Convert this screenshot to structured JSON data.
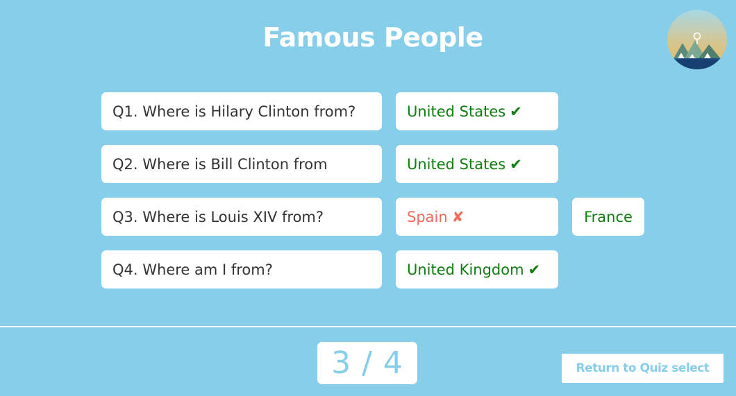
{
  "page": {
    "title": "Famous People"
  },
  "questions": [
    {
      "text": "Q1. Where is Hilary Clinton from?",
      "answer": "United States",
      "mark": "✔",
      "status": "correct"
    },
    {
      "text": "Q2. Where is Bill Clinton from",
      "answer": "United States",
      "mark": "✔",
      "status": "correct"
    },
    {
      "text": "Q3. Where is Louis XIV from?",
      "answer": "Spain",
      "mark": "✘",
      "status": "wrong",
      "correct_answer": "France"
    },
    {
      "text": "Q4. Where am I from?",
      "answer": "United Kingdom",
      "mark": "✔",
      "status": "correct"
    }
  ],
  "score": {
    "text": "3 / 4",
    "correct": 3,
    "total": 4
  },
  "footer": {
    "return_label": "Return to Quiz select"
  },
  "colors": {
    "background": "#87ceeb",
    "correct": "#0f7d0f",
    "wrong": "#f26a5a",
    "card": "#ffffff",
    "question_text": "#333333"
  },
  "icons": {
    "avatar": "landscape-map-pin-avatar",
    "correct": "check-mark-icon",
    "wrong": "cross-mark-icon"
  }
}
